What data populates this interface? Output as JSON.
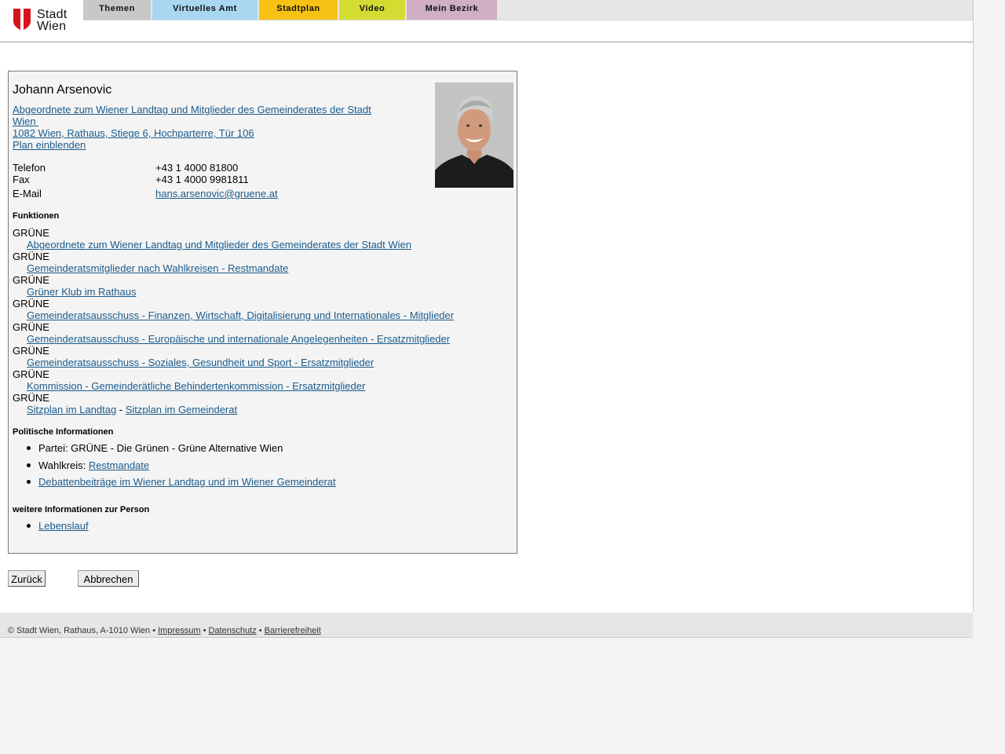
{
  "header": {
    "logo": {
      "line1": "Stadt",
      "line2": "Wien",
      "icon": "vienna-shield-icon",
      "color": "#d7141a"
    },
    "tabs": [
      {
        "label": "Themen",
        "color": "#c8c8c8"
      },
      {
        "label": "Virtuelles Amt",
        "color": "#a9d6f0"
      },
      {
        "label": "Stadtplan",
        "color": "#f7c214"
      },
      {
        "label": "Video",
        "color": "#d4dc32"
      },
      {
        "label": "Mein Bezirk",
        "color": "#cfaec6"
      }
    ]
  },
  "person": {
    "name": "Johann Arsenovic",
    "role_line1": "Abgeordnete zum Wiener Landtag und Mitglieder des Gemeinderates der Stadt",
    "role_line2": "Wien ",
    "address": "1082 Wien, Rathaus, Stiege 6, Hochparterre, Tür 106",
    "plan_link": "Plan einblenden",
    "contacts": [
      {
        "label": "Telefon",
        "value": "+43 1 4000 81800"
      },
      {
        "label": "Fax",
        "value": "+43 1 4000 9981811"
      },
      {
        "label": "E-Mail",
        "value": "hans.arsenovic@gruene.at"
      }
    ]
  },
  "functions": {
    "heading": "Funktionen",
    "items": [
      {
        "party": "GRÜNE",
        "links": [
          "Abgeordnete zum Wiener Landtag und Mitglieder des Gemeinderates der Stadt Wien"
        ]
      },
      {
        "party": "GRÜNE",
        "links": [
          "Gemeinderatsmitglieder nach Wahlkreisen - Restmandate"
        ]
      },
      {
        "party": "GRÜNE",
        "links": [
          "Grüner Klub im Rathaus"
        ]
      },
      {
        "party": "GRÜNE",
        "links": [
          "Gemeinderatsausschuss - Finanzen, Wirtschaft, Digitalisierung und Internationales - Mitglieder"
        ]
      },
      {
        "party": "GRÜNE",
        "links": [
          "Gemeinderatsausschuss - Europäische und internationale Angelegenheiten - Ersatzmitglieder"
        ]
      },
      {
        "party": "GRÜNE",
        "links": [
          "Gemeinderatsausschuss - Soziales, Gesundheit und Sport - Ersatzmitglieder"
        ]
      },
      {
        "party": "GRÜNE",
        "links": [
          "Kommission - Gemeinderätliche Behindertenkommission - Ersatzmitglieder"
        ]
      },
      {
        "party": "GRÜNE",
        "links": [
          "Sitzplan im Landtag",
          "Sitzplan im Gemeinderat"
        ],
        "separator": " - "
      }
    ]
  },
  "political": {
    "heading": "Politische Informationen",
    "party_text": "Partei: GRÜNE - Die Grünen - Grüne Alternative Wien",
    "constituency_label": "Wahlkreis: ",
    "constituency_link": "Restmandate",
    "debates_link": "Debattenbeiträge im Wiener Landtag und im Wiener Gemeinderat"
  },
  "more": {
    "heading": "weitere Informationen zur Person",
    "cv_link": "Lebenslauf"
  },
  "buttons": {
    "back": "Zurück",
    "cancel": "Abbrechen"
  },
  "footer": {
    "copyright": "© Stadt Wien, Rathaus, A-1010 Wien",
    "sep": " • ",
    "links": [
      "Impressum",
      "Datenschutz",
      "Barrierefreiheit"
    ]
  }
}
